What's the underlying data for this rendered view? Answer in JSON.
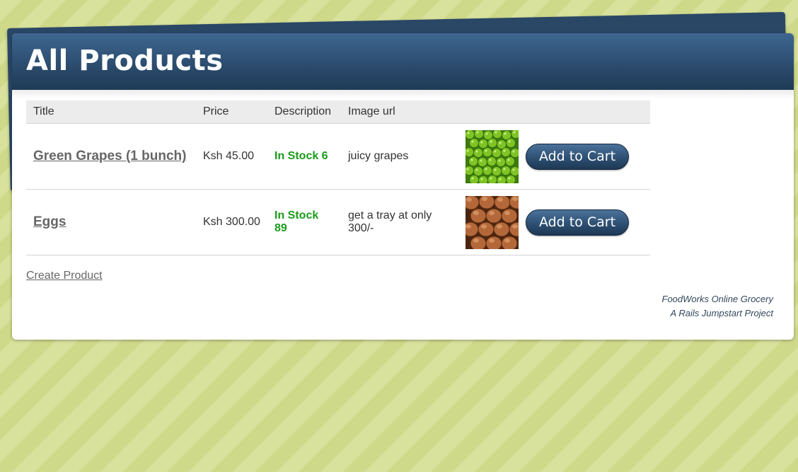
{
  "page": {
    "title": "All Products"
  },
  "table": {
    "headers": [
      "Title",
      "Price",
      "Description",
      "Image url",
      "",
      ""
    ],
    "rows": [
      {
        "title": "Green Grapes (1 bunch)",
        "price": "Ksh 45.00",
        "stock": "In Stock 6",
        "description": "juicy grapes",
        "image": "green-grapes-image",
        "action": "Add to Cart"
      },
      {
        "title": "Eggs",
        "price": "Ksh 300.00",
        "stock": "In Stock 89",
        "description": "get a tray at only 300/-",
        "image": "brown-eggs-image",
        "action": "Add to Cart"
      }
    ]
  },
  "links": {
    "create_product": "Create Product"
  },
  "footer": {
    "line1": "FoodWorks Online Grocery",
    "line2": "A Rails Jumpstart Project"
  },
  "colors": {
    "header": "#2c4d6f",
    "stock": "#1a9c1a",
    "background": "#d6e095"
  }
}
